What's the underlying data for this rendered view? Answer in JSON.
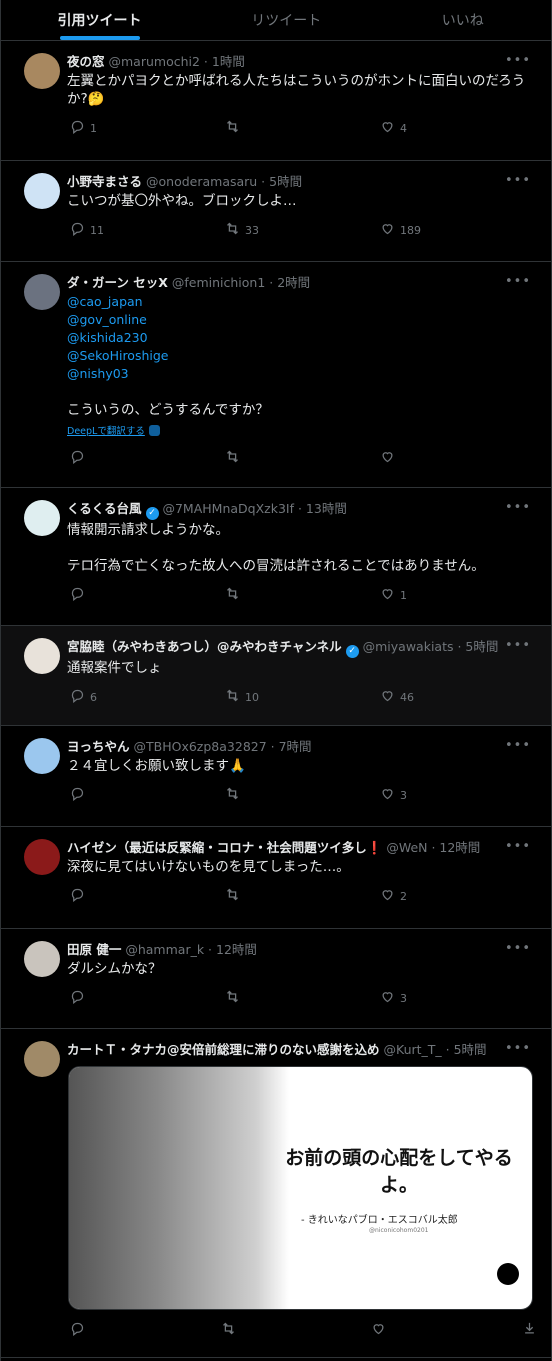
{
  "tabs": [
    "引用ツイート",
    "リツイート",
    "いいね"
  ],
  "tweets": [
    {
      "name": "夜の窓",
      "handle": "@marumochi2 · 1時間",
      "text": "左翼とかパヨクとか呼ばれる人たちはこういうのがホントに面白いのだろうか?🤔",
      "reply": "1",
      "retweet": "",
      "like": "4"
    },
    {
      "name": "小野寺まさる",
      "handle": "@onoderamasaru · 5時間",
      "text": "こいつが基〇外やね。ブロックしよ…",
      "reply": "11",
      "retweet": "33",
      "like": "189"
    },
    {
      "name": "ダ・ガーン セッX",
      "handle": "@feminichion1 · 2時間",
      "mentions": [
        "@cao_japan",
        "@gov_online",
        "@kishida230",
        "@SekoHiroshige",
        "@nishy03"
      ],
      "text": "こういうの、どうするんですか？",
      "translate": "DeepLで翻訳する",
      "reply": "",
      "retweet": "",
      "like": ""
    },
    {
      "name": "くるくる台風",
      "handle": "@7MAHMnaDqXzk3If · 13時間",
      "text": "情報開示請求しようかな。\n\nテロ行為で亡くなった故人への冒涜は許されることではありません。",
      "reply": "",
      "retweet": "",
      "like": "1"
    },
    {
      "name": "宮脇睦（みやわきあつし）@みやわきチャンネル",
      "handle": "@miyawakiats · 5時間",
      "text": "通報案件でしょ",
      "reply": "6",
      "retweet": "10",
      "like": "46"
    },
    {
      "name": "ヨっちやん",
      "handle": "@TBHOx6zp8a32827 · 7時間",
      "text": "２４宜しくお願い致します🙏",
      "reply": "",
      "retweet": "",
      "like": "3"
    },
    {
      "name": "ハイゼン（最近は反緊縮・コロナ・社会問題ツイ多し❗",
      "handle": "@WeN · 12時間",
      "text": "深夜に見てはいけないものを見てしまった…。",
      "reply": "",
      "retweet": "",
      "like": "2"
    },
    {
      "name": "田原 健一",
      "handle": "@hammar_k · 12時間",
      "text": "ダルシムかな？",
      "reply": "",
      "retweet": "",
      "like": "3"
    },
    {
      "name": "カートＴ・タナカ@安倍前総理に滞りのない感謝を込め",
      "handle": "@Kurt_T_ · 5時間",
      "text": "",
      "media_quote": "お前の頭の心配をしてやるよ。",
      "media_attrib": "- きれいなパブロ・エスコバル太郎",
      "media_small": "@niconicohom0201",
      "reply": "",
      "retweet": "",
      "like": ""
    }
  ],
  "colors": {
    "accent": "#1d9bf0",
    "background": "#000000",
    "muted": "#71767b"
  }
}
